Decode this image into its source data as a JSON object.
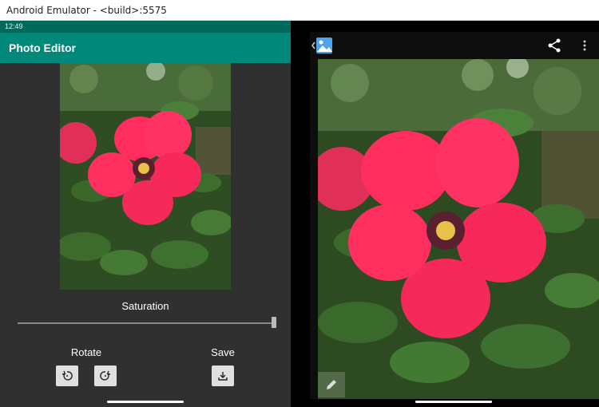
{
  "window": {
    "title": "Android Emulator - <build>:5575"
  },
  "left_screen": {
    "status_time": "12:49",
    "app_title": "Photo Editor",
    "saturation_label": "Saturation",
    "saturation_value": 1.0,
    "rotate_label": "Rotate",
    "save_label": "Save"
  },
  "right_screen": {
    "icons": [
      "gallery-back-icon",
      "share-icon",
      "more-vert-icon",
      "edit-pencil-icon"
    ]
  },
  "colors": {
    "app_bar": "#00897b",
    "status_bar": "#00695c",
    "background": "#303030",
    "flower": "#ff2a5a"
  }
}
